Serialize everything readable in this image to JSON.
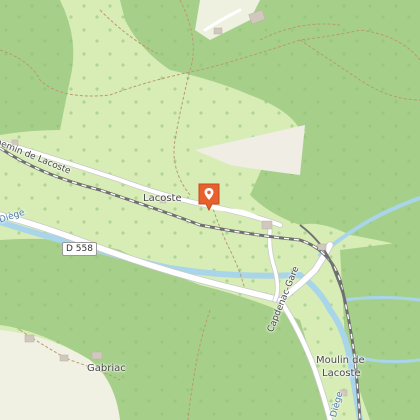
{
  "map": {
    "labels": {
      "road_chemin_lacoste": "Chemin de Lacoste",
      "place_lacoste": "Lacoste",
      "road_d558": "D 558",
      "road_capdenac_gare": "Capdenac-Gare",
      "place_moulin_line1": "Moulin de",
      "place_moulin_line2": "Lacoste",
      "place_gabriac": "Gabriac",
      "river_diege_left": "Diège",
      "river_diege_bottom": "Diège"
    },
    "marker": {
      "icon": "map-pin-icon",
      "color": "#e8602c"
    },
    "colors": {
      "forest": "#a6d08a",
      "meadow": "#d8edb6",
      "residential": "#f1f1e3",
      "water": "#a8d5ea",
      "road": "#ffffff",
      "rail": "#707070"
    }
  }
}
